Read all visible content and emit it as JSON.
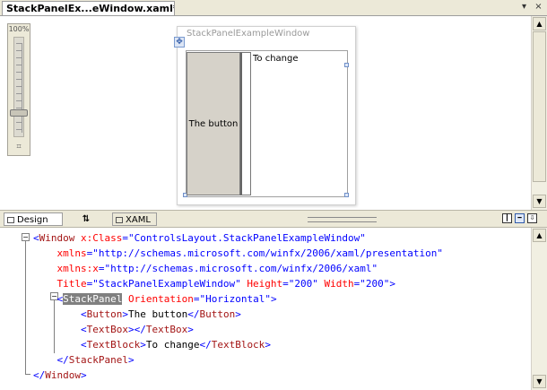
{
  "document_tab": {
    "title": "StackPanelEx...eWindow.xaml*"
  },
  "tab_controls": {
    "dropdown": "▾",
    "close": "×"
  },
  "zoom": {
    "label": "100%",
    "level_fraction": 0.2
  },
  "preview": {
    "window_title": "StackPanelExampleWindow",
    "button_text": "The button",
    "textblock_text": "To change"
  },
  "view_tabs": [
    {
      "label": "Design"
    },
    {
      "label": "⇅"
    },
    {
      "label": "XAML"
    }
  ],
  "code_lines": [
    [
      {
        "t": "<",
        "c": "delim"
      },
      {
        "t": "Window ",
        "c": "tag"
      },
      {
        "t": "x:Class",
        "c": "attr"
      },
      {
        "t": "=\"ControlsLayout.StackPanelExampleWindow\"",
        "c": "val"
      }
    ],
    [
      {
        "t": "    xmlns",
        "c": "attr"
      },
      {
        "t": "=\"http://schemas.microsoft.com/winfx/2006/xaml/presentation\"",
        "c": "val"
      }
    ],
    [
      {
        "t": "    xmlns:x",
        "c": "attr"
      },
      {
        "t": "=\"http://schemas.microsoft.com/winfx/2006/xaml\"",
        "c": "val"
      }
    ],
    [
      {
        "t": "    Title",
        "c": "attr"
      },
      {
        "t": "=\"StackPanelExampleWindow\" ",
        "c": "val"
      },
      {
        "t": "Height",
        "c": "attr"
      },
      {
        "t": "=\"200\" ",
        "c": "val"
      },
      {
        "t": "Width",
        "c": "attr"
      },
      {
        "t": "=\"200\"",
        "c": "val"
      },
      {
        "t": ">",
        "c": "delim"
      }
    ],
    [
      {
        "t": "    <",
        "c": "delim"
      },
      {
        "t": "StackPanel",
        "c": "hl"
      },
      {
        "t": " Orientation",
        "c": "attr"
      },
      {
        "t": "=\"Horizontal\"",
        "c": "val"
      },
      {
        "t": ">",
        "c": "delim"
      }
    ],
    [
      {
        "t": "        <",
        "c": "delim"
      },
      {
        "t": "Button",
        "c": "tag"
      },
      {
        "t": ">",
        "c": "delim"
      },
      {
        "t": "The button",
        "c": "txt"
      },
      {
        "t": "</",
        "c": "delim"
      },
      {
        "t": "Button",
        "c": "tag"
      },
      {
        "t": ">",
        "c": "delim"
      }
    ],
    [
      {
        "t": "        <",
        "c": "delim"
      },
      {
        "t": "TextBox",
        "c": "tag"
      },
      {
        "t": "></",
        "c": "delim"
      },
      {
        "t": "TextBox",
        "c": "tag"
      },
      {
        "t": ">",
        "c": "delim"
      }
    ],
    [
      {
        "t": "        <",
        "c": "delim"
      },
      {
        "t": "TextBlock",
        "c": "tag"
      },
      {
        "t": ">",
        "c": "delim"
      },
      {
        "t": "To change",
        "c": "txt"
      },
      {
        "t": "</",
        "c": "delim"
      },
      {
        "t": "TextBlock",
        "c": "tag"
      },
      {
        "t": ">",
        "c": "delim"
      }
    ],
    [
      {
        "t": "    </",
        "c": "delim"
      },
      {
        "t": "StackPanel",
        "c": "tag"
      },
      {
        "t": ">",
        "c": "delim"
      }
    ],
    [
      {
        "t": "</",
        "c": "delim"
      },
      {
        "t": "Window",
        "c": "tag"
      },
      {
        "t": ">",
        "c": "delim"
      }
    ]
  ],
  "colors": {
    "tag": "#a31515",
    "attribute": "#ff0000",
    "value": "#0000ff",
    "highlight": "#808080",
    "chrome": "#ece9d8"
  }
}
